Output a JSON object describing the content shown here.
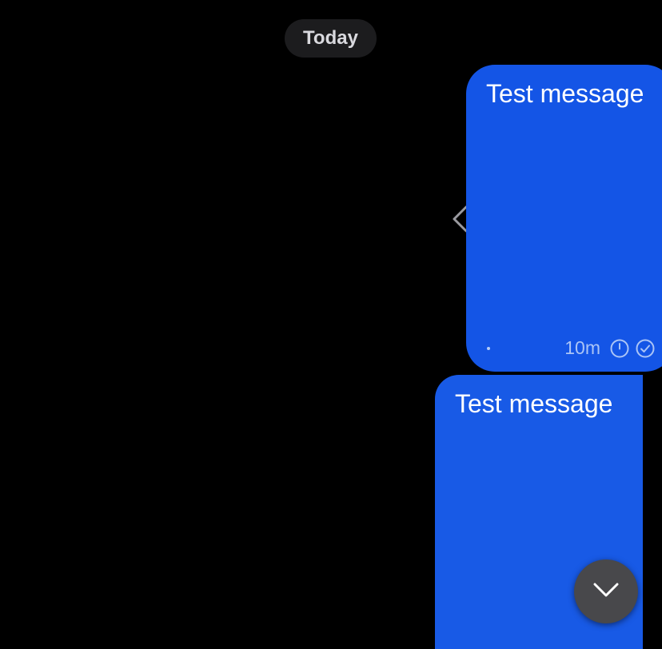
{
  "date_separator": {
    "label": "Today"
  },
  "messages": [
    {
      "text": "Test message",
      "time": "10m",
      "status_icons": [
        "clock-icon",
        "check-circle-icon"
      ]
    },
    {
      "text": "Test message",
      "status_icons": [
        "clock-icon",
        "check-circle-icon"
      ]
    }
  ],
  "controls": {
    "scroll_down_icon": "chevron-down-icon",
    "swipe_reply_icon": "chevron-left-icon"
  },
  "colors": {
    "background": "#000000",
    "date_pill": "#1c1c1e",
    "outgoing_bubble": "#1455e6",
    "meta_text": "#aac4f6",
    "scroll_button": "#48484b"
  }
}
